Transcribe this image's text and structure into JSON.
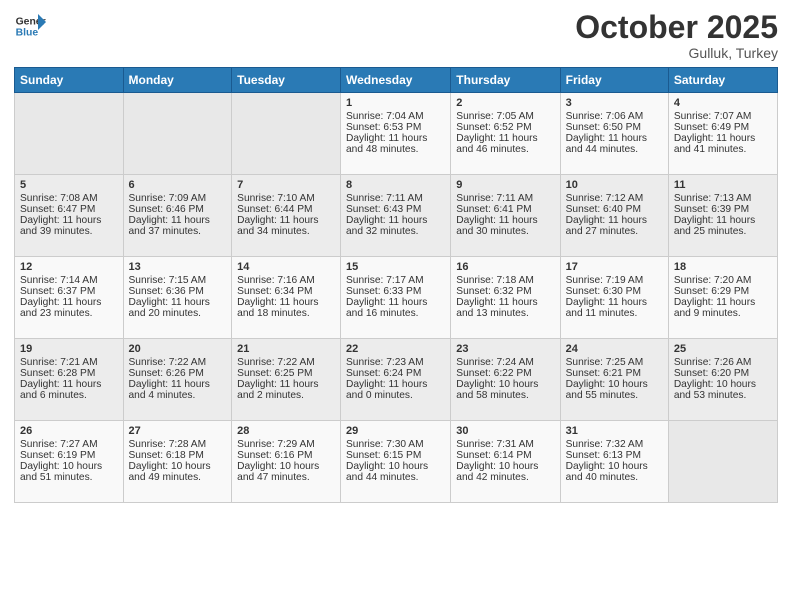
{
  "header": {
    "logo_line1": "General",
    "logo_line2": "Blue",
    "month": "October 2025",
    "location": "Gulluk, Turkey"
  },
  "weekdays": [
    "Sunday",
    "Monday",
    "Tuesday",
    "Wednesday",
    "Thursday",
    "Friday",
    "Saturday"
  ],
  "weeks": [
    [
      {
        "day": "",
        "info": ""
      },
      {
        "day": "",
        "info": ""
      },
      {
        "day": "",
        "info": ""
      },
      {
        "day": "1",
        "info": "Sunrise: 7:04 AM\nSunset: 6:53 PM\nDaylight: 11 hours\nand 48 minutes."
      },
      {
        "day": "2",
        "info": "Sunrise: 7:05 AM\nSunset: 6:52 PM\nDaylight: 11 hours\nand 46 minutes."
      },
      {
        "day": "3",
        "info": "Sunrise: 7:06 AM\nSunset: 6:50 PM\nDaylight: 11 hours\nand 44 minutes."
      },
      {
        "day": "4",
        "info": "Sunrise: 7:07 AM\nSunset: 6:49 PM\nDaylight: 11 hours\nand 41 minutes."
      }
    ],
    [
      {
        "day": "5",
        "info": "Sunrise: 7:08 AM\nSunset: 6:47 PM\nDaylight: 11 hours\nand 39 minutes."
      },
      {
        "day": "6",
        "info": "Sunrise: 7:09 AM\nSunset: 6:46 PM\nDaylight: 11 hours\nand 37 minutes."
      },
      {
        "day": "7",
        "info": "Sunrise: 7:10 AM\nSunset: 6:44 PM\nDaylight: 11 hours\nand 34 minutes."
      },
      {
        "day": "8",
        "info": "Sunrise: 7:11 AM\nSunset: 6:43 PM\nDaylight: 11 hours\nand 32 minutes."
      },
      {
        "day": "9",
        "info": "Sunrise: 7:11 AM\nSunset: 6:41 PM\nDaylight: 11 hours\nand 30 minutes."
      },
      {
        "day": "10",
        "info": "Sunrise: 7:12 AM\nSunset: 6:40 PM\nDaylight: 11 hours\nand 27 minutes."
      },
      {
        "day": "11",
        "info": "Sunrise: 7:13 AM\nSunset: 6:39 PM\nDaylight: 11 hours\nand 25 minutes."
      }
    ],
    [
      {
        "day": "12",
        "info": "Sunrise: 7:14 AM\nSunset: 6:37 PM\nDaylight: 11 hours\nand 23 minutes."
      },
      {
        "day": "13",
        "info": "Sunrise: 7:15 AM\nSunset: 6:36 PM\nDaylight: 11 hours\nand 20 minutes."
      },
      {
        "day": "14",
        "info": "Sunrise: 7:16 AM\nSunset: 6:34 PM\nDaylight: 11 hours\nand 18 minutes."
      },
      {
        "day": "15",
        "info": "Sunrise: 7:17 AM\nSunset: 6:33 PM\nDaylight: 11 hours\nand 16 minutes."
      },
      {
        "day": "16",
        "info": "Sunrise: 7:18 AM\nSunset: 6:32 PM\nDaylight: 11 hours\nand 13 minutes."
      },
      {
        "day": "17",
        "info": "Sunrise: 7:19 AM\nSunset: 6:30 PM\nDaylight: 11 hours\nand 11 minutes."
      },
      {
        "day": "18",
        "info": "Sunrise: 7:20 AM\nSunset: 6:29 PM\nDaylight: 11 hours\nand 9 minutes."
      }
    ],
    [
      {
        "day": "19",
        "info": "Sunrise: 7:21 AM\nSunset: 6:28 PM\nDaylight: 11 hours\nand 6 minutes."
      },
      {
        "day": "20",
        "info": "Sunrise: 7:22 AM\nSunset: 6:26 PM\nDaylight: 11 hours\nand 4 minutes."
      },
      {
        "day": "21",
        "info": "Sunrise: 7:22 AM\nSunset: 6:25 PM\nDaylight: 11 hours\nand 2 minutes."
      },
      {
        "day": "22",
        "info": "Sunrise: 7:23 AM\nSunset: 6:24 PM\nDaylight: 11 hours\nand 0 minutes."
      },
      {
        "day": "23",
        "info": "Sunrise: 7:24 AM\nSunset: 6:22 PM\nDaylight: 10 hours\nand 58 minutes."
      },
      {
        "day": "24",
        "info": "Sunrise: 7:25 AM\nSunset: 6:21 PM\nDaylight: 10 hours\nand 55 minutes."
      },
      {
        "day": "25",
        "info": "Sunrise: 7:26 AM\nSunset: 6:20 PM\nDaylight: 10 hours\nand 53 minutes."
      }
    ],
    [
      {
        "day": "26",
        "info": "Sunrise: 7:27 AM\nSunset: 6:19 PM\nDaylight: 10 hours\nand 51 minutes."
      },
      {
        "day": "27",
        "info": "Sunrise: 7:28 AM\nSunset: 6:18 PM\nDaylight: 10 hours\nand 49 minutes."
      },
      {
        "day": "28",
        "info": "Sunrise: 7:29 AM\nSunset: 6:16 PM\nDaylight: 10 hours\nand 47 minutes."
      },
      {
        "day": "29",
        "info": "Sunrise: 7:30 AM\nSunset: 6:15 PM\nDaylight: 10 hours\nand 44 minutes."
      },
      {
        "day": "30",
        "info": "Sunrise: 7:31 AM\nSunset: 6:14 PM\nDaylight: 10 hours\nand 42 minutes."
      },
      {
        "day": "31",
        "info": "Sunrise: 7:32 AM\nSunset: 6:13 PM\nDaylight: 10 hours\nand 40 minutes."
      },
      {
        "day": "",
        "info": ""
      }
    ]
  ]
}
